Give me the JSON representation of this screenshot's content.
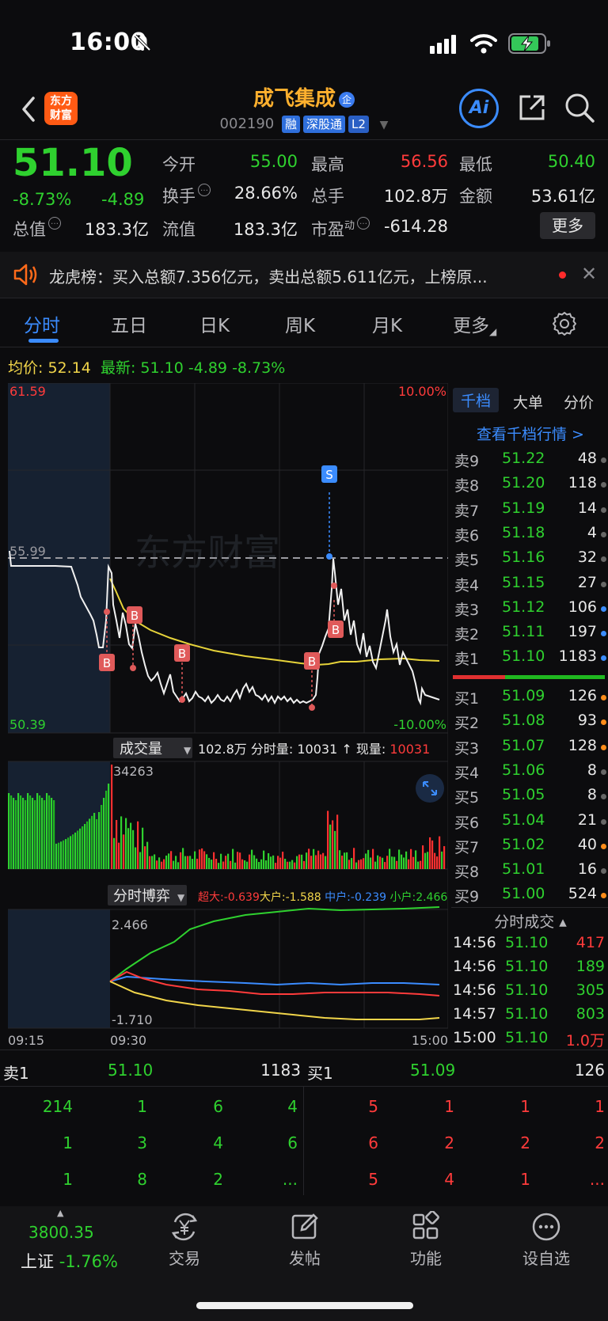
{
  "status_bar": {
    "time": "16:00"
  },
  "header": {
    "logo_line1": "东方",
    "logo_line2": "财富",
    "stock_name": "成飞集成",
    "stock_badge": "企",
    "stock_code": "002190",
    "tags": [
      "融",
      "深股通",
      "L2"
    ],
    "ai_label": "Ai"
  },
  "quote": {
    "price": "51.10",
    "change_pct": "-8.73%",
    "change_amt": "-4.89",
    "open_label": "今开",
    "open": "55.00",
    "high_label": "最高",
    "high": "56.56",
    "low_label": "最低",
    "low": "50.40",
    "turnover_label": "换手",
    "turnover": "28.66%",
    "volume_label": "总手",
    "volume": "102.8万",
    "amount_label": "金额",
    "amount": "53.61亿",
    "mktcap_label": "总值",
    "mktcap": "183.3亿",
    "float_label": "流值",
    "float_cap": "183.3亿",
    "pe_label": "市盈",
    "pe_sup": "动",
    "pe": "-614.28",
    "more_label": "更多"
  },
  "news": {
    "text": "龙虎榜：买入总额7.356亿元，卖出总额5.611亿元，上榜原..."
  },
  "tabs": [
    "分时",
    "五日",
    "日K",
    "周K",
    "月K",
    "更多"
  ],
  "avg_row": {
    "avg_label": "均价:",
    "avg_value": "52.14",
    "latest_label": "最新:",
    "latest_value": "51.10",
    "latest_chg": "-4.89",
    "latest_pct": "-8.73%"
  },
  "chart_labels": {
    "top_price": "61.59",
    "top_pct": "10.00%",
    "ref_price": "55.99",
    "bottom_price": "50.39",
    "bottom_pct": "-10.00%",
    "watermark": "东方财富",
    "vol_selector": "成交量",
    "vol_info_1": "102.8万 分时量: 10031",
    "vol_info_arrow": "↑",
    "vol_info_2": " 现量: ",
    "vol_info_now": "10031",
    "vol_max": "34263",
    "game_selector": "分时博弈",
    "game_super": "超大:-0.639",
    "game_big": "大户:-1.588",
    "game_mid": "中户:-0.239",
    "game_small": "小户:2.466",
    "game_top": "2.466",
    "game_bottom": "-1.710",
    "time_start": "09:15",
    "time_open": "09:30",
    "time_end": "15:00",
    "marker_b": "B",
    "marker_s": "S"
  },
  "order_book": {
    "tabs": [
      "千档",
      "大单",
      "分价"
    ],
    "link": "查看千档行情 >",
    "asks": [
      {
        "label": "卖9",
        "price": "51.22",
        "vol": "48",
        "dot": "#666666"
      },
      {
        "label": "卖8",
        "price": "51.20",
        "vol": "118",
        "dot": "#666666"
      },
      {
        "label": "卖7",
        "price": "51.19",
        "vol": "14",
        "dot": "#666666"
      },
      {
        "label": "卖6",
        "price": "51.18",
        "vol": "4",
        "dot": "#666666"
      },
      {
        "label": "卖5",
        "price": "51.16",
        "vol": "32",
        "dot": "#666666"
      },
      {
        "label": "卖4",
        "price": "51.15",
        "vol": "27",
        "dot": "#666666"
      },
      {
        "label": "卖3",
        "price": "51.12",
        "vol": "106",
        "dot": "#3b8cff"
      },
      {
        "label": "卖2",
        "price": "51.11",
        "vol": "197",
        "dot": "#3b8cff"
      },
      {
        "label": "卖1",
        "price": "51.10",
        "vol": "1183",
        "dot": "#3b8cff"
      }
    ],
    "bids": [
      {
        "label": "买1",
        "price": "51.09",
        "vol": "126",
        "dot": "#ff8c1a"
      },
      {
        "label": "买2",
        "price": "51.08",
        "vol": "93",
        "dot": "#ff8c1a"
      },
      {
        "label": "买3",
        "price": "51.07",
        "vol": "128",
        "dot": "#ff8c1a"
      },
      {
        "label": "买4",
        "price": "51.06",
        "vol": "8",
        "dot": "#666666"
      },
      {
        "label": "买5",
        "price": "51.05",
        "vol": "8",
        "dot": "#666666"
      },
      {
        "label": "买6",
        "price": "51.04",
        "vol": "21",
        "dot": "#666666"
      },
      {
        "label": "买7",
        "price": "51.02",
        "vol": "40",
        "dot": "#ff8c1a"
      },
      {
        "label": "买8",
        "price": "51.01",
        "vol": "16",
        "dot": "#666666"
      },
      {
        "label": "买9",
        "price": "51.00",
        "vol": "524",
        "dot": "#ff8c1a"
      }
    ]
  },
  "trades": {
    "title": "分时成交 ▴",
    "rows": [
      {
        "time": "14:56",
        "price": "51.10",
        "vol": "417",
        "color": "#ff3b3b"
      },
      {
        "time": "14:56",
        "price": "51.10",
        "vol": "189",
        "color": "#2fd12f"
      },
      {
        "time": "14:56",
        "price": "51.10",
        "vol": "305",
        "color": "#2fd12f"
      },
      {
        "time": "14:57",
        "price": "51.10",
        "vol": "803",
        "color": "#2fd12f"
      },
      {
        "time": "15:00",
        "price": "51.10",
        "vol": "1.0万",
        "color": "#ff3b3b"
      }
    ]
  },
  "level1": {
    "sell_label": "卖1",
    "sell_price": "51.10",
    "sell_vol": "1183",
    "buy_label": "买1",
    "buy_price": "51.09",
    "buy_vol": "126",
    "sell_grid": [
      [
        "214",
        "1",
        "6",
        "4"
      ],
      [
        "1",
        "3",
        "4",
        "6"
      ],
      [
        "1",
        "8",
        "2",
        "..."
      ]
    ],
    "buy_grid": [
      [
        "5",
        "1",
        "1",
        "1"
      ],
      [
        "6",
        "2",
        "2",
        "2"
      ],
      [
        "5",
        "4",
        "1",
        "..."
      ]
    ]
  },
  "bottom_nav": {
    "index_value": "3800.35",
    "index_name": "上证",
    "index_pct": "-1.76%",
    "items": [
      "交易",
      "发帖",
      "功能",
      "设自选"
    ]
  }
}
